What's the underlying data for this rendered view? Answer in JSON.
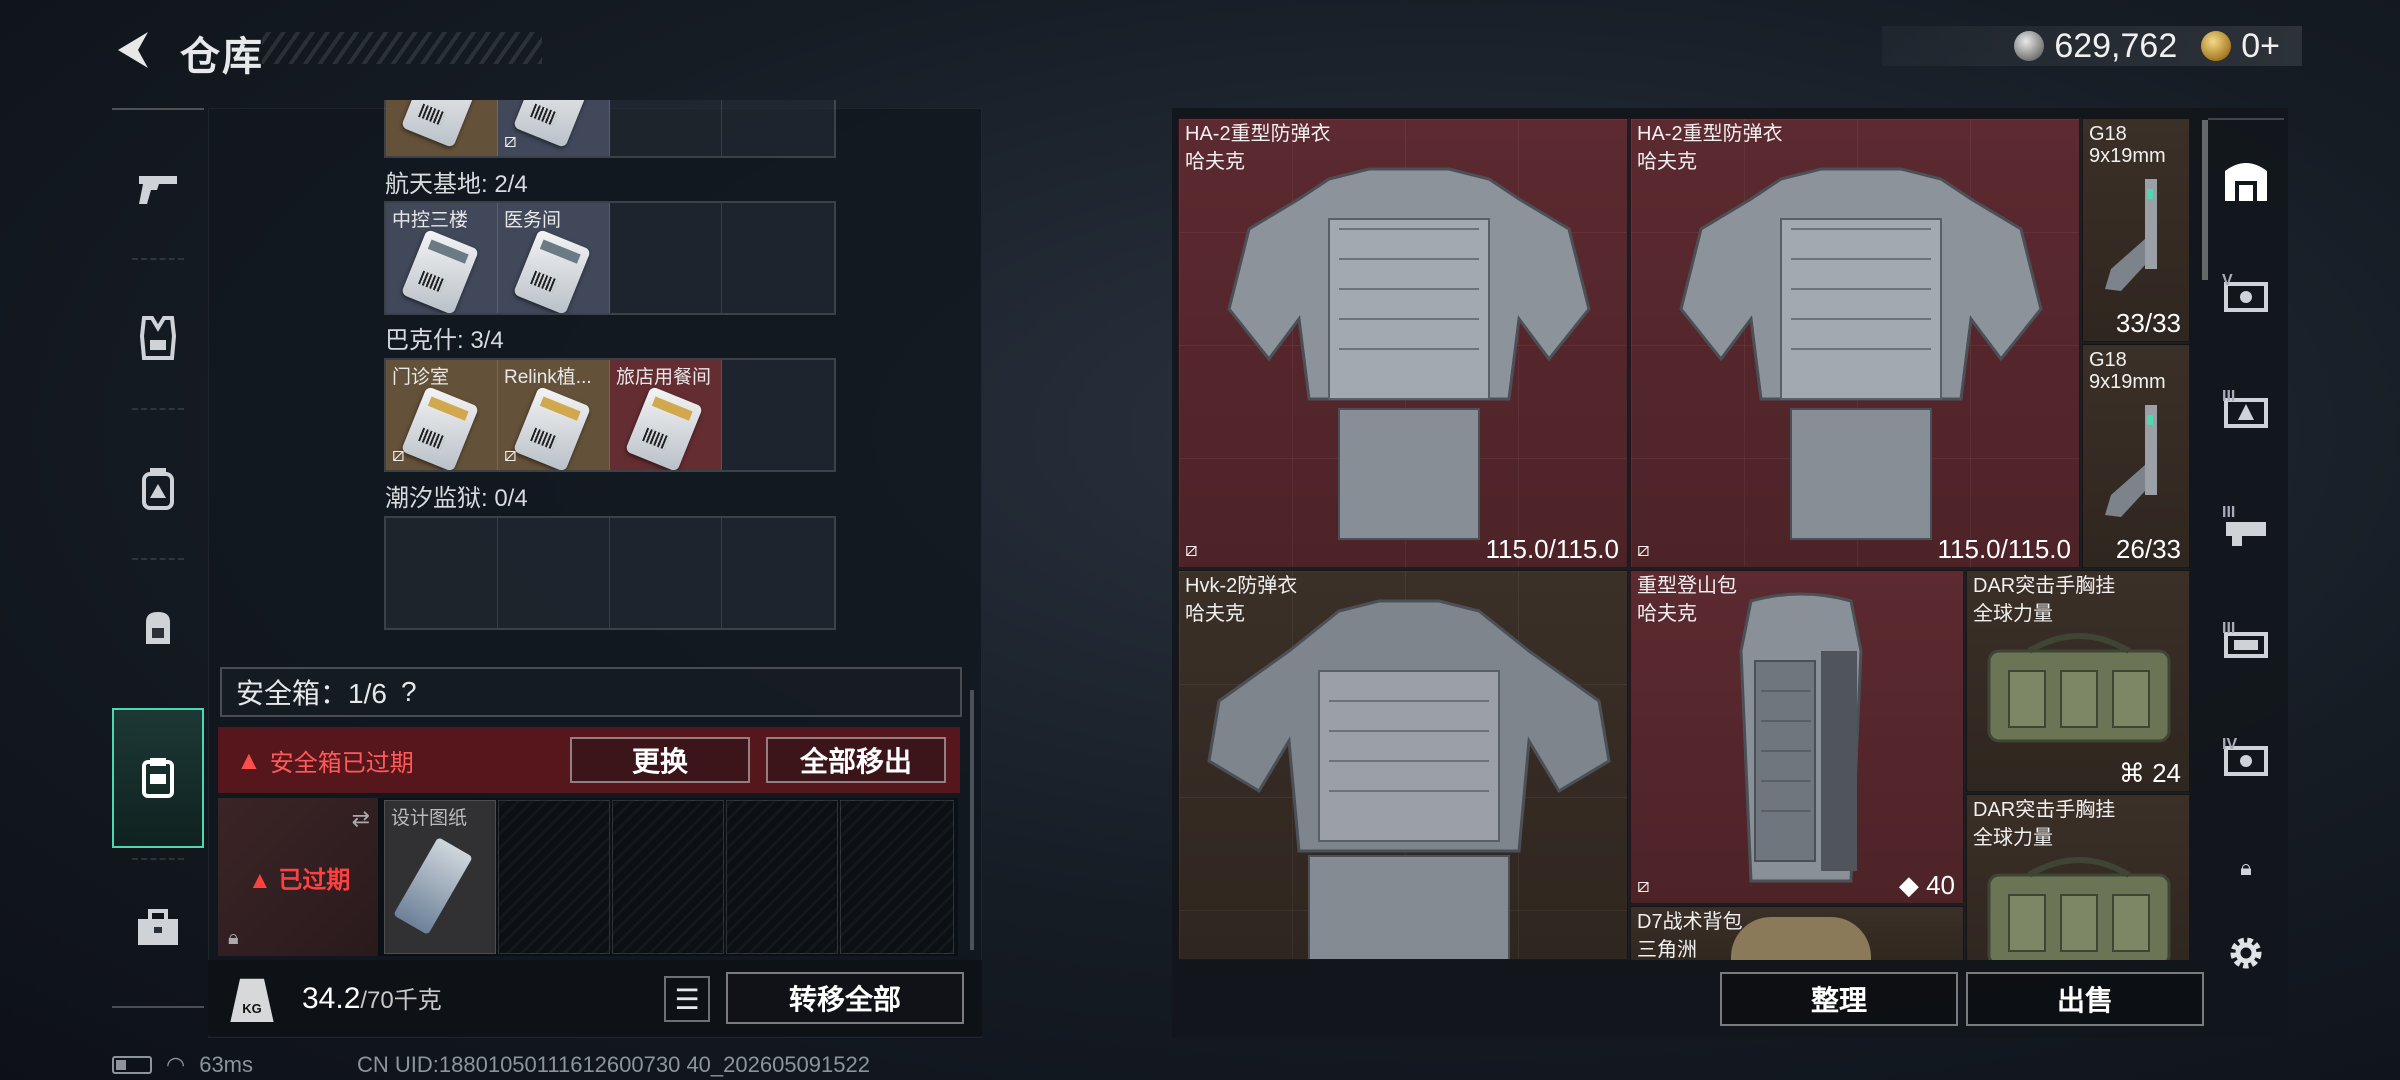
{
  "header": {
    "title": "仓库",
    "currencies": [
      {
        "icon": "silver-coin-icon",
        "value": "629,762"
      },
      {
        "icon": "gold-coin-icon",
        "value": "0+"
      }
    ]
  },
  "left_nav": {
    "items": [
      {
        "name": "weapons",
        "icon": "gun-icon"
      },
      {
        "name": "armor",
        "icon": "vest-icon"
      },
      {
        "name": "backpack",
        "icon": "backpack-icon"
      },
      {
        "name": "bag",
        "icon": "bag-icon"
      },
      {
        "name": "keycards",
        "icon": "keycard-icon",
        "active": true
      },
      {
        "name": "case",
        "icon": "briefcase-icon"
      }
    ]
  },
  "stash": {
    "maps": [
      {
        "label": "航天基地: 2/4",
        "slots": [
          {
            "name": "中控三楼",
            "tone": "blue"
          },
          {
            "name": "医务间",
            "tone": "blue"
          },
          null,
          null
        ]
      },
      {
        "label": "巴克什: 3/4",
        "slots": [
          {
            "name": "门诊室",
            "tone": "gold",
            "nosale": true
          },
          {
            "name": "Relink植...",
            "tone": "gold",
            "nosale": true
          },
          {
            "name": "旅店用餐间",
            "tone": "red"
          },
          null
        ]
      },
      {
        "label": "潮汐监狱: 0/4",
        "slots": [
          null,
          null,
          null,
          null
        ]
      }
    ],
    "safebox": {
      "title": "安全箱：1/6",
      "help": "?",
      "expired_notice": "安全箱已过期",
      "replace_button": "更换",
      "remove_all_button": "全部移出",
      "case_status": "已过期",
      "blueprint_label": "设计图纸"
    },
    "weight": {
      "current": "34.2",
      "max": "/70千克",
      "icon_text": "KG"
    },
    "transfer_all_button": "转移全部"
  },
  "storage": {
    "items": [
      {
        "name": "HA-2重型防弹衣",
        "brand": "哈夫克",
        "durability": "115.0/115.0",
        "tone": "red"
      },
      {
        "name": "HA-2重型防弹衣",
        "brand": "哈夫克",
        "durability": "115.0/115.0",
        "tone": "red"
      },
      {
        "name": "G18",
        "sub": "9x19mm",
        "ammo": "33/33",
        "tone": "brown"
      },
      {
        "name": "G18",
        "sub": "9x19mm",
        "ammo": "26/33",
        "tone": "brown"
      },
      {
        "name": "Hvk-2防弹衣",
        "brand": "哈夫克",
        "tone": "brown"
      },
      {
        "name": "重型登山包",
        "brand": "哈夫克",
        "capacity": "40",
        "tone": "red"
      },
      {
        "name": "DAR突击手胸挂",
        "brand": "全球力量",
        "capacity": "24",
        "tone": "brown"
      },
      {
        "name": "DAR突击手胸挂",
        "brand": "全球力量",
        "tone": "brown"
      },
      {
        "name": "D7战术背包",
        "brand": "三角洲",
        "tone": "brown"
      }
    ],
    "sort_button": "整理",
    "sell_button": "出售"
  },
  "status_bar": {
    "ping": "63ms",
    "uid": "CN UID:18801050111612600730 40_202605091522"
  }
}
